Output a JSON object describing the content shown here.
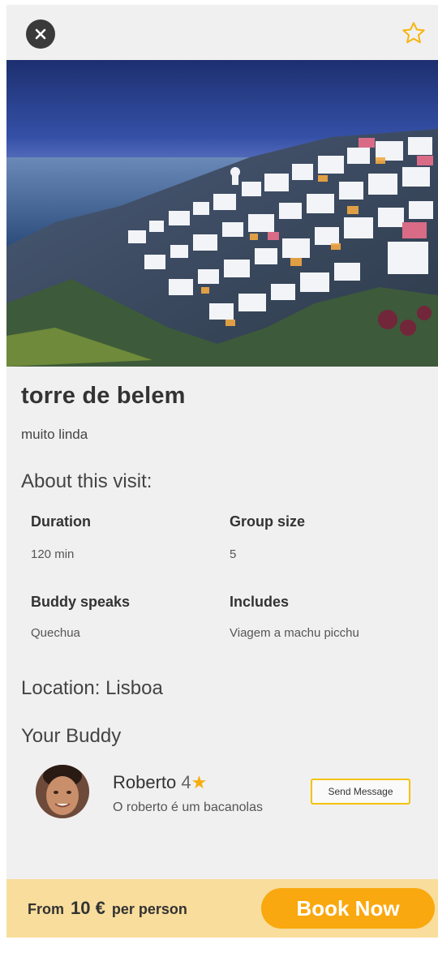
{
  "header": {
    "close_icon": "close-icon",
    "favorite_icon": "star-outline-icon"
  },
  "visit": {
    "title": "torre de belem",
    "subtitle": "muito linda",
    "about_heading": "About this visit:",
    "details": {
      "duration_label": "Duration",
      "duration_value": "120 min",
      "group_label": "Group size",
      "group_value": "5",
      "speaks_label": "Buddy speaks",
      "speaks_value": "Quechua",
      "includes_label": "Includes",
      "includes_value": "Viagem a machu picchu"
    },
    "location": "Location: Lisboa"
  },
  "buddy": {
    "heading": "Your Buddy",
    "name": "Roberto",
    "rating": "4",
    "description": "O roberto é um bacanolas",
    "message_button": "Send Message"
  },
  "booking": {
    "from_label": "From",
    "price": "10 €",
    "per_label": "per person",
    "book_button": "Book Now"
  },
  "colors": {
    "accent": "#f9a80f",
    "footer_bg": "#f8dd9c",
    "star": "#f6ad0c",
    "message_border": "#f4c200"
  }
}
